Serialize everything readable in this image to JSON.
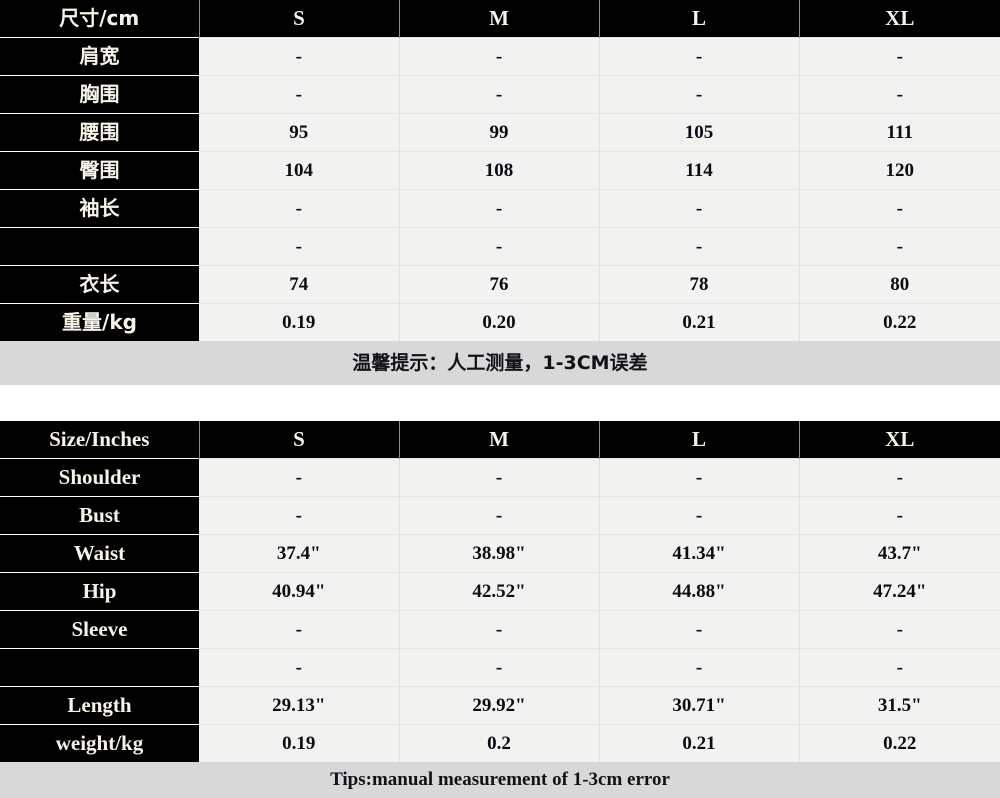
{
  "cm_table": {
    "header": {
      "label": "尺寸/cm",
      "sizes": [
        "S",
        "M",
        "L",
        "XL"
      ]
    },
    "rows": [
      {
        "label": "肩宽",
        "values": [
          "-",
          "-",
          "-",
          "-"
        ]
      },
      {
        "label": "胸围",
        "values": [
          "-",
          "-",
          "-",
          "-"
        ]
      },
      {
        "label": "腰围",
        "values": [
          "95",
          "99",
          "105",
          "111"
        ]
      },
      {
        "label": "臀围",
        "values": [
          "104",
          "108",
          "114",
          "120"
        ]
      },
      {
        "label": "袖长",
        "values": [
          "-",
          "-",
          "-",
          "-"
        ]
      },
      {
        "label": "",
        "values": [
          "-",
          "-",
          "-",
          "-"
        ]
      },
      {
        "label": "衣长",
        "values": [
          "74",
          "76",
          "78",
          "80"
        ]
      },
      {
        "label": "重量/kg",
        "values": [
          "0.19",
          "0.20",
          "0.21",
          "0.22"
        ]
      }
    ],
    "tip": "温馨提示：人工测量，1-3CM误差"
  },
  "inch_table": {
    "header": {
      "label": "Size/Inches",
      "sizes": [
        "S",
        "M",
        "L",
        "XL"
      ]
    },
    "rows": [
      {
        "label": "Shoulder",
        "values": [
          "-",
          "-",
          "-",
          "-"
        ]
      },
      {
        "label": "Bust",
        "values": [
          "-",
          "-",
          "-",
          "-"
        ]
      },
      {
        "label": "Waist",
        "values": [
          "37.4\"",
          "38.98\"",
          "41.34\"",
          "43.7\""
        ]
      },
      {
        "label": "Hip",
        "values": [
          "40.94\"",
          "42.52\"",
          "44.88\"",
          "47.24\""
        ]
      },
      {
        "label": "Sleeve",
        "values": [
          "-",
          "-",
          "-",
          "-"
        ]
      },
      {
        "label": "",
        "values": [
          "-",
          "-",
          "-",
          "-"
        ]
      },
      {
        "label": "Length",
        "values": [
          "29.13\"",
          "29.92\"",
          "30.71\"",
          "31.5\""
        ]
      },
      {
        "label": "weight/kg",
        "values": [
          "0.19",
          "0.2",
          "0.21",
          "0.22"
        ]
      }
    ],
    "tip": "Tips:manual measurement of 1-3cm error"
  },
  "colors": {
    "header_bg": "#000000",
    "header_text": "#f7f3ea",
    "cell_bg": "#f2f2f0",
    "cell_text": "#0b0b14",
    "tip_bg": "#d8d8d8"
  }
}
